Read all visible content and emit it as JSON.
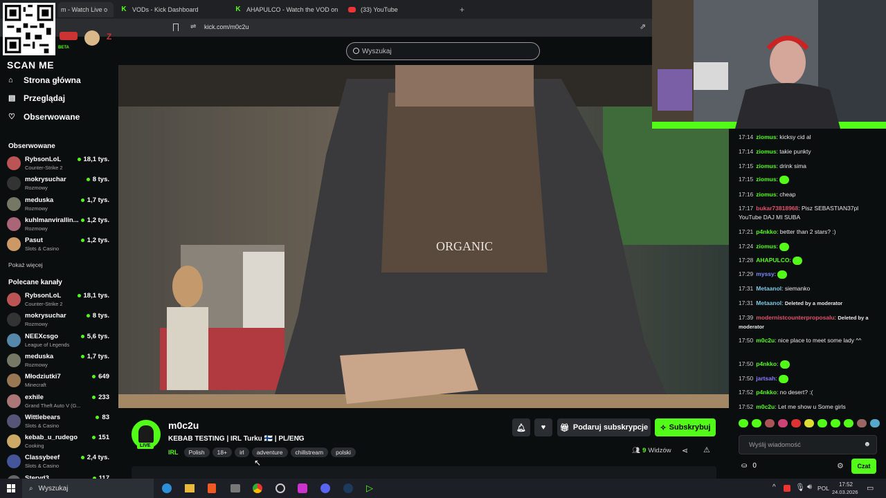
{
  "browser": {
    "tabs": [
      {
        "label": "m - Watch Live o",
        "icon": "kick-icon",
        "active": true
      },
      {
        "label": "VODs - Kick Dashboard",
        "icon": "kick-icon"
      },
      {
        "label": "AHAPULCO - Watch the VOD on Kick",
        "icon": "kick-icon"
      },
      {
        "label": "(33) YouTube",
        "icon": "youtube-icon"
      }
    ],
    "url": "kick.com/m0c2u"
  },
  "overlay": {
    "scan_me": "SCAN ME",
    "beta": "BETA"
  },
  "search": {
    "placeholder": "Wyszukaj"
  },
  "nav": [
    {
      "label": "Strona główna",
      "icon": "home-icon"
    },
    {
      "label": "Przeglądaj",
      "icon": "browse-icon"
    },
    {
      "label": "Obserwowane",
      "icon": "heart-icon"
    }
  ],
  "followed": {
    "title": "Obserwowane",
    "channels": [
      {
        "name": "RybsonLoL",
        "category": "Counter-Strike 2",
        "viewers": "18,1 tys.",
        "color": "#b55"
      },
      {
        "name": "mokrysuchar",
        "category": "Rozmowy",
        "viewers": "8 tys.",
        "color": "#333"
      },
      {
        "name": "meduska",
        "category": "Rozmowy",
        "viewers": "1,7 tys.",
        "color": "#776"
      },
      {
        "name": "kuhlmanvirallin...",
        "category": "Rozmowy",
        "viewers": "1,2 tys.",
        "color": "#a67"
      },
      {
        "name": "Pasut",
        "category": "Slots & Casino",
        "viewers": "1,2 tys.",
        "color": "#c96"
      }
    ],
    "show_more": "Pokaż więcej"
  },
  "recommended": {
    "title": "Polecane kanały",
    "channels": [
      {
        "name": "RybsonLoL",
        "category": "Counter-Strike 2",
        "viewers": "18,1 tys.",
        "color": "#b55"
      },
      {
        "name": "mokrysuchar",
        "category": "Rozmowy",
        "viewers": "8 tys.",
        "color": "#333"
      },
      {
        "name": "NEEXcsgo",
        "category": "League of Legends",
        "viewers": "5,6 tys.",
        "color": "#58a"
      },
      {
        "name": "meduska",
        "category": "Rozmowy",
        "viewers": "1,7 tys.",
        "color": "#776"
      },
      {
        "name": "Młodziutki7",
        "category": "Minecraft",
        "viewers": "649",
        "color": "#975"
      },
      {
        "name": "exhile",
        "category": "Grand Theft Auto V (G...",
        "viewers": "233",
        "color": "#a77"
      },
      {
        "name": "Wittlebears",
        "category": "Slots & Casino",
        "viewers": "83",
        "color": "#557"
      },
      {
        "name": "kebab_u_rudego",
        "category": "Cooking",
        "viewers": "151",
        "color": "#ca6"
      },
      {
        "name": "Classybeef",
        "category": "Slots & Casino",
        "viewers": "2,4 tys.",
        "color": "#459"
      },
      {
        "name": "Steryd3",
        "category": "",
        "viewers": "117",
        "color": "#666"
      }
    ]
  },
  "stream": {
    "channel": "m0c2u",
    "title": "KEBAB TESTING | IRL Turku 🇫🇮 | PL/ENG",
    "live_badge": "LIVE",
    "category": "IRL",
    "tags": [
      "Polish",
      "18+",
      "irl",
      "adventure",
      "chillstream",
      "polski"
    ],
    "viewers_count": "9",
    "viewers_label": "Widzów",
    "gift_label": "Podaruj subskrypcje",
    "subscribe_label": "Subskrybuj",
    "accent": "#53fc18"
  },
  "chat": {
    "messages": [
      {
        "time": "17:14",
        "user": "ziomus",
        "color": "#53fc18",
        "text": "kicksy cid al"
      },
      {
        "time": "17:14",
        "user": "ziomus",
        "color": "#53fc18",
        "text": "takie punkty"
      },
      {
        "time": "17:15",
        "user": "ziomus",
        "color": "#53fc18",
        "text": "drink sima"
      },
      {
        "time": "17:15",
        "user": "ziomus",
        "color": "#53fc18",
        "text": "",
        "emote": true
      },
      {
        "time": "17:16",
        "user": "ziomus",
        "color": "#53fc18",
        "text": "cheap"
      },
      {
        "time": "17:17",
        "user": "bukar73818968",
        "color": "#e0526b",
        "text": "Pisz SEBASTIAN37pl YouTube DAJ MI SUBA"
      },
      {
        "time": "17:21",
        "user": "p4nkko",
        "color": "#53fc18",
        "text": "better than 2 stars? :)"
      },
      {
        "time": "17:24",
        "user": "ziomus",
        "color": "#53fc18",
        "text": "",
        "emote": true
      },
      {
        "time": "17:28",
        "user": "AHAPULCO",
        "color": "#53fc18",
        "text": "",
        "emote": true
      },
      {
        "time": "17:29",
        "user": "myssy",
        "color": "#7b8cff",
        "text": "",
        "emote": true
      },
      {
        "time": "17:31",
        "user": "Metaanol",
        "color": "#7ec8e3",
        "text": "siemanko"
      },
      {
        "time": "17:31",
        "user": "Metaanol",
        "color": "#7ec8e3",
        "text": "Deleted by a moderator"
      },
      {
        "time": "17:39",
        "user": "modernistcounterproposalu",
        "color": "#e0526b",
        "text": "Deleted by a moderator"
      },
      {
        "time": "17:50",
        "user": "m0c2u",
        "color": "#53fc18",
        "text": "nice place to meet some lady ^^"
      },
      {
        "time": "17:50",
        "user": "p4nkko",
        "color": "#53fc18",
        "text": "",
        "emote": true
      },
      {
        "time": "17:50",
        "user": "jartsah",
        "color": "#8a7cff",
        "text": "",
        "emote": true
      },
      {
        "time": "17:52",
        "user": "p4nkko",
        "color": "#53fc18",
        "text": "no desert? :("
      },
      {
        "time": "17:52",
        "user": "m0c2u",
        "color": "#53fc18",
        "text": "Let me show u Some girls"
      }
    ],
    "input_placeholder": "Wyślij wiadomość",
    "points": "0",
    "send_label": "Czat"
  },
  "taskbar": {
    "search_placeholder": "Wyszukaj",
    "lang": "POL",
    "time": "17:52",
    "date": "24.03.2026"
  }
}
